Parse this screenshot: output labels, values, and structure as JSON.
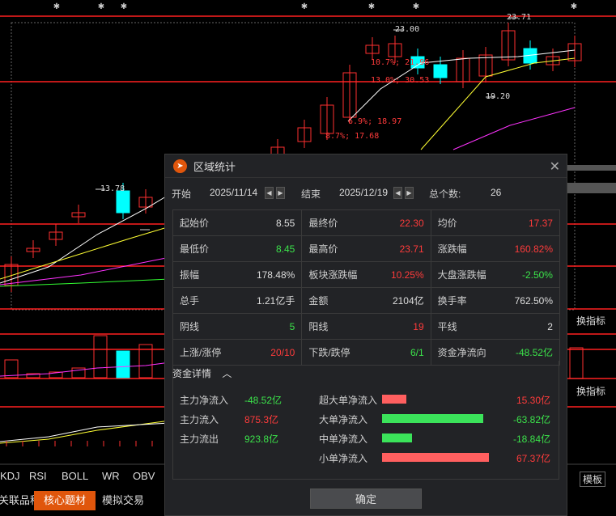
{
  "chart": {
    "price_labels": [
      "23.71",
      "23.00",
      "19.20",
      "13.78"
    ],
    "annotations": [
      "10.7%; 21.96",
      "13.0%; 30.53",
      "6.9%; 18.97",
      "8.7%; 17.68"
    ],
    "indicator_tabs": [
      "KDJ",
      "RSI",
      "BOLL",
      "WR",
      "OBV"
    ],
    "side_buttons": {
      "indicator1": "换指标",
      "indicator2": "换指标",
      "template": "模板"
    },
    "bottom_tabs": [
      "关联品种",
      "核心题材",
      "模拟交易"
    ],
    "colors": {
      "up": "#ff3030",
      "down": "#00ffff",
      "ma_white": "#ffffff",
      "ma_yellow": "#ffff33",
      "ma_magenta": "#ff33ff",
      "ma_green": "#33ff33"
    }
  },
  "dialog": {
    "title": "区域统计",
    "close_icon": "close-icon",
    "start_label": "开始",
    "start_date": "2025/11/14",
    "end_label": "结束",
    "end_date": "2025/12/19",
    "count_label": "总个数:",
    "count_value": "26",
    "stats": [
      [
        {
          "label": "起始价",
          "value": "8.55",
          "tone": "white"
        },
        {
          "label": "最终价",
          "value": "22.30",
          "tone": "red"
        },
        {
          "label": "均价",
          "value": "17.37",
          "tone": "red"
        }
      ],
      [
        {
          "label": "最低价",
          "value": "8.45",
          "tone": "green"
        },
        {
          "label": "最高价",
          "value": "23.71",
          "tone": "red"
        },
        {
          "label": "涨跌幅",
          "value": "160.82%",
          "tone": "red"
        }
      ],
      [
        {
          "label": "振幅",
          "value": "178.48%",
          "tone": "white"
        },
        {
          "label": "板块涨跌幅",
          "value": "10.25%",
          "tone": "red"
        },
        {
          "label": "大盘涨跌幅",
          "value": "-2.50%",
          "tone": "green"
        }
      ],
      [
        {
          "label": "总手",
          "value": "1.21亿手",
          "tone": "white"
        },
        {
          "label": "金额",
          "value": "2104亿",
          "tone": "white"
        },
        {
          "label": "换手率",
          "value": "762.50%",
          "tone": "white"
        }
      ],
      [
        {
          "label": "阴线",
          "value": "5",
          "tone": "green"
        },
        {
          "label": "阳线",
          "value": "19",
          "tone": "red"
        },
        {
          "label": "平线",
          "value": "2",
          "tone": "white"
        }
      ],
      [
        {
          "label": "上涨/涨停",
          "value": "20/10",
          "tone": "red"
        },
        {
          "label": "下跌/跌停",
          "value": "6/1",
          "tone": "green"
        },
        {
          "label": "资金净流向",
          "value": "-48.52亿",
          "tone": "green"
        }
      ]
    ],
    "fund_title": "资金详情",
    "fund_left": [
      {
        "label": "主力净流入",
        "value": "-48.52亿",
        "tone": "green"
      },
      {
        "label": "主力流入",
        "value": "875.3亿",
        "tone": "red"
      },
      {
        "label": "主力流出",
        "value": "923.8亿",
        "tone": "green"
      }
    ],
    "fund_right": [
      {
        "label": "超大单净流入",
        "value": "15.30亿",
        "tone": "red",
        "bar_fraction": 0.23,
        "bar_color": "#ff5f5f"
      },
      {
        "label": "大单净流入",
        "value": "-63.82亿",
        "tone": "green",
        "bar_fraction": 0.95,
        "bar_color": "#3be35a"
      },
      {
        "label": "中单净流入",
        "value": "-18.84亿",
        "tone": "green",
        "bar_fraction": 0.28,
        "bar_color": "#3be35a"
      },
      {
        "label": "小单净流入",
        "value": "67.37亿",
        "tone": "red",
        "bar_fraction": 1.0,
        "bar_color": "#ff5f5f"
      }
    ],
    "confirm_label": "确定"
  }
}
